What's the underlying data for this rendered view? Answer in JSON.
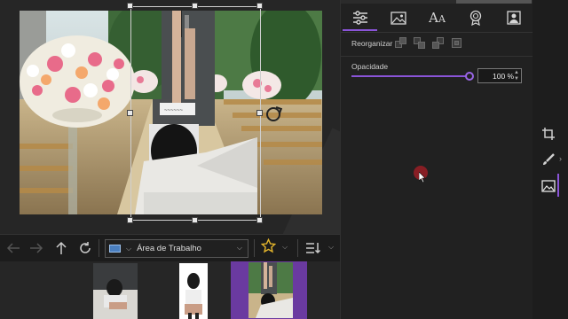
{
  "editor": {
    "canvas": "wedding-aisle-photo",
    "layer": "standing-person-cutout"
  },
  "navigation": {
    "back_icon": "arrow-left-icon",
    "forward_icon": "arrow-right-icon",
    "up_icon": "arrow-up-icon",
    "refresh_icon": "refresh-icon",
    "location_label": "Área de Trabalho",
    "favorites_icon": "star-icon",
    "sort_icon": "sort-list-icon"
  },
  "thumbnails": {
    "items": [
      {
        "name": "thumb-1",
        "selected": false
      },
      {
        "name": "thumb-2",
        "selected": false
      },
      {
        "name": "thumb-3",
        "selected": true
      }
    ]
  },
  "panel": {
    "tabs": [
      {
        "icon": "sliders-icon",
        "active": true
      },
      {
        "icon": "image-icon",
        "active": false
      },
      {
        "icon": "text-icon",
        "active": false,
        "label": "A"
      },
      {
        "icon": "badge-icon",
        "active": false
      },
      {
        "icon": "portrait-icon",
        "active": false
      }
    ],
    "reorganize_label": "Reorganizar",
    "opacity_label": "Opacidade",
    "opacity_value": "100 %",
    "opacity_fraction": 1.0
  },
  "sidebar": {
    "tools": [
      "crop-icon",
      "brush-icon",
      "image-edit-icon"
    ]
  },
  "colors": {
    "accent": "#8a54d8",
    "star": "#e5b62c"
  }
}
